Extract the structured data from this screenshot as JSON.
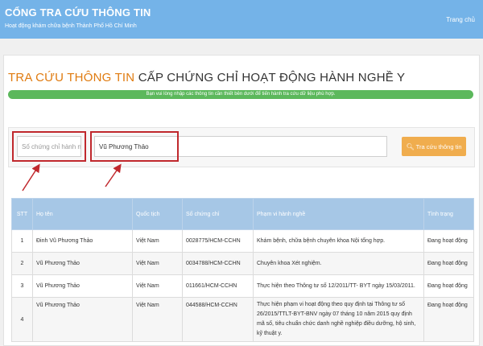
{
  "header": {
    "title": "CỔNG TRA CỨU THÔNG TIN",
    "subtitle": "Hoạt động khám chữa bệnh Thành Phố Hồ Chí Minh",
    "home_link": "Trang chủ"
  },
  "page": {
    "title_highlight": "TRA CỨU THÔNG TIN",
    "title_rest": " CẤP CHỨNG CHỈ HOẠT ĐỘNG HÀNH NGHỀ Y",
    "info_text": "Bạn vui lòng nhập các thông tin cần thiết bên dưới để tiến hành tra cứu dữ liệu phù hợp."
  },
  "search": {
    "cert_placeholder": "Số chứng chỉ hành nghề",
    "cert_value": "",
    "name_value": "Vũ Phương Thảo",
    "button_label": "Tra cứu thông tin"
  },
  "table": {
    "headers": {
      "stt": "STT",
      "name": "Họ tên",
      "nationality": "Quốc tịch",
      "cert_no": "Số chứng chỉ",
      "scope": "Phạm vi hành nghề",
      "status": "Tình trạng"
    },
    "rows": [
      {
        "stt": "1",
        "name": "Đinh Vũ Phương Thảo",
        "nationality": "Việt Nam",
        "cert_no": "0028775/HCM-CCHN",
        "scope": "Khám bệnh, chữa bệnh chuyên khoa Nội tổng hợp.",
        "status": "Đang hoạt động"
      },
      {
        "stt": "2",
        "name": "Vũ Phương Thảo",
        "nationality": "Việt Nam",
        "cert_no": "0034788/HCM-CCHN",
        "scope": "Chuyên khoa Xét nghiệm.",
        "status": "Đang hoạt động"
      },
      {
        "stt": "3",
        "name": "Vũ Phương Thảo",
        "nationality": "Việt Nam",
        "cert_no": "011661/HCM-CCHN",
        "scope": "Thực hiện theo Thông tư số 12/2011/TT- BYT ngày 15/03/2011.",
        "status": "Đang hoạt động"
      },
      {
        "stt": "4",
        "name": "Vũ Phương Thảo",
        "nationality": "Việt Nam",
        "cert_no": "044588/HCM-CCHN",
        "scope": "Thực hiện phạm vi hoạt động theo quy định tại Thông tư số 26/2015/TTLT-BYT-BNV ngày 07 tháng 10 năm 2015 quy định mã số, tiêu chuẩn chức danh nghề nghiệp điều dưỡng, hộ sinh, kỹ thuật y.",
        "status": "Đang hoạt động"
      }
    ]
  },
  "colors": {
    "topbar": "#74b3e8",
    "title_accent": "#e07b10",
    "info_bar": "#5cb85c",
    "search_button": "#f0ad4e",
    "table_header": "#a6c7e6",
    "highlight_annotation": "#c0282d",
    "link": "#3c73b4"
  },
  "icons": {
    "search_button_icon": "search-icon"
  }
}
